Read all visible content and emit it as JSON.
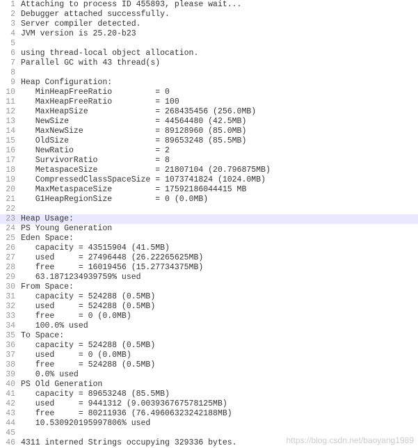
{
  "lines": [
    {
      "n": 1,
      "t": "Attaching to process ID 455893, please wait..."
    },
    {
      "n": 2,
      "t": "Debugger attached successfully."
    },
    {
      "n": 3,
      "t": "Server compiler detected."
    },
    {
      "n": 4,
      "t": "JVM version is 25.20-b23"
    },
    {
      "n": 5,
      "t": ""
    },
    {
      "n": 6,
      "t": "using thread-local object allocation."
    },
    {
      "n": 7,
      "t": "Parallel GC with 43 thread(s)"
    },
    {
      "n": 8,
      "t": ""
    },
    {
      "n": 9,
      "t": "Heap Configuration:"
    },
    {
      "n": 10,
      "t": "   MinHeapFreeRatio         = 0"
    },
    {
      "n": 11,
      "t": "   MaxHeapFreeRatio         = 100"
    },
    {
      "n": 12,
      "t": "   MaxHeapSize              = 268435456 (256.0MB)"
    },
    {
      "n": 13,
      "t": "   NewSize                  = 44564480 (42.5MB)"
    },
    {
      "n": 14,
      "t": "   MaxNewSize               = 89128960 (85.0MB)"
    },
    {
      "n": 15,
      "t": "   OldSize                  = 89653248 (85.5MB)"
    },
    {
      "n": 16,
      "t": "   NewRatio                 = 2"
    },
    {
      "n": 17,
      "t": "   SurvivorRatio            = 8"
    },
    {
      "n": 18,
      "t": "   MetaspaceSize            = 21807104 (20.796875MB)"
    },
    {
      "n": 19,
      "t": "   CompressedClassSpaceSize = 1073741824 (1024.0MB)"
    },
    {
      "n": 20,
      "t": "   MaxMetaspaceSize         = 17592186044415 MB"
    },
    {
      "n": 21,
      "t": "   G1HeapRegionSize         = 0 (0.0MB)"
    },
    {
      "n": 22,
      "t": ""
    },
    {
      "n": 23,
      "t": "Heap Usage:",
      "hl": true
    },
    {
      "n": 24,
      "t": "PS Young Generation"
    },
    {
      "n": 25,
      "t": "Eden Space:"
    },
    {
      "n": 26,
      "t": "   capacity = 43515904 (41.5MB)"
    },
    {
      "n": 27,
      "t": "   used     = 27496448 (26.22265625MB)"
    },
    {
      "n": 28,
      "t": "   free     = 16019456 (15.27734375MB)"
    },
    {
      "n": 29,
      "t": "   63.1871234939759% used"
    },
    {
      "n": 30,
      "t": "From Space:"
    },
    {
      "n": 31,
      "t": "   capacity = 524288 (0.5MB)"
    },
    {
      "n": 32,
      "t": "   used     = 524288 (0.5MB)"
    },
    {
      "n": 33,
      "t": "   free     = 0 (0.0MB)"
    },
    {
      "n": 34,
      "t": "   100.0% used"
    },
    {
      "n": 35,
      "t": "To Space:"
    },
    {
      "n": 36,
      "t": "   capacity = 524288 (0.5MB)"
    },
    {
      "n": 37,
      "t": "   used     = 0 (0.0MB)"
    },
    {
      "n": 38,
      "t": "   free     = 524288 (0.5MB)"
    },
    {
      "n": 39,
      "t": "   0.0% used"
    },
    {
      "n": 40,
      "t": "PS Old Generation"
    },
    {
      "n": 41,
      "t": "   capacity = 89653248 (85.5MB)"
    },
    {
      "n": 42,
      "t": "   used     = 9441312 (9.003936767578125MB)"
    },
    {
      "n": 43,
      "t": "   free     = 80211936 (76.49606323242188MB)"
    },
    {
      "n": 44,
      "t": "   10.530920195997806% used"
    },
    {
      "n": 45,
      "t": ""
    },
    {
      "n": 46,
      "t": "4311 interned Strings occupying 329336 bytes."
    }
  ],
  "watermark": "https://blog.csdn.net/baoyang1989"
}
